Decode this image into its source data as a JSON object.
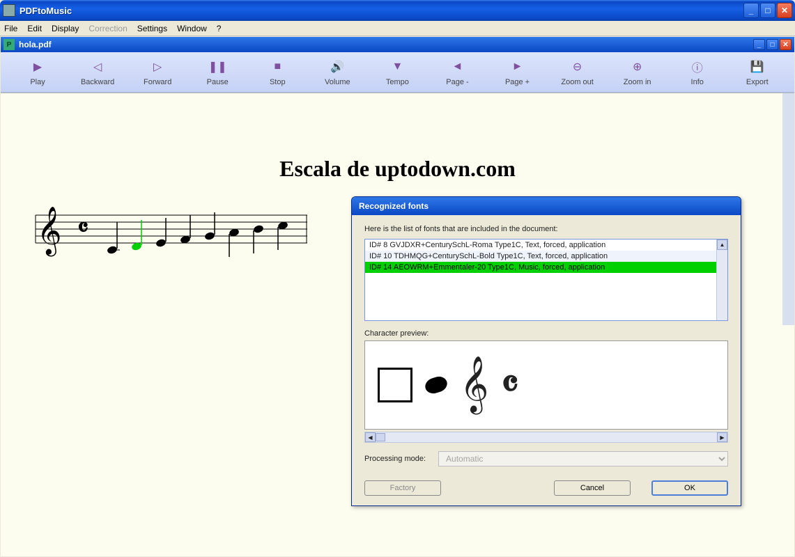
{
  "app": {
    "title": "PDFtoMusic"
  },
  "menu": {
    "items": [
      "File",
      "Edit",
      "Display",
      "Correction",
      "Settings",
      "Window",
      "?"
    ],
    "disabled_index": 3
  },
  "document": {
    "title": "hola.pdf",
    "heading": "Escala de uptodown.com"
  },
  "toolbar": [
    {
      "label": "Play",
      "icon": "▶"
    },
    {
      "label": "Backward",
      "icon": "◁"
    },
    {
      "label": "Forward",
      "icon": "▷"
    },
    {
      "label": "Pause",
      "icon": "❚❚"
    },
    {
      "label": "Stop",
      "icon": "■"
    },
    {
      "label": "Volume",
      "icon": "🔊"
    },
    {
      "label": "Tempo",
      "icon": "▼"
    },
    {
      "label": "Page -",
      "icon": "◄"
    },
    {
      "label": "Page +",
      "icon": "►"
    },
    {
      "label": "Zoom out",
      "icon": "⊖"
    },
    {
      "label": "Zoom in",
      "icon": "⊕"
    },
    {
      "label": "Info",
      "icon": "ⓘ"
    },
    {
      "label": "Export",
      "icon": "💾"
    }
  ],
  "dialog": {
    "title": "Recognized fonts",
    "intro": "Here is the list of fonts that are included in the document:",
    "fonts": [
      "ID# 8 GVJDXR+CenturySchL-Roma Type1C, Text, forced, application",
      "ID# 10 TDHMQG+CenturySchL-Bold Type1C, Text, forced, application",
      "ID# 14 AEOWRM+Emmentaler-20 Type1C, Music, forced, application"
    ],
    "selected_font_index": 2,
    "char_preview_label": "Character preview:",
    "preview_glyphs": [
      "□",
      "●",
      "𝄞",
      "𝄴"
    ],
    "processing_mode_label": "Processing mode:",
    "processing_mode_value": "Automatic",
    "buttons": {
      "factory": "Factory",
      "cancel": "Cancel",
      "ok": "OK"
    }
  }
}
